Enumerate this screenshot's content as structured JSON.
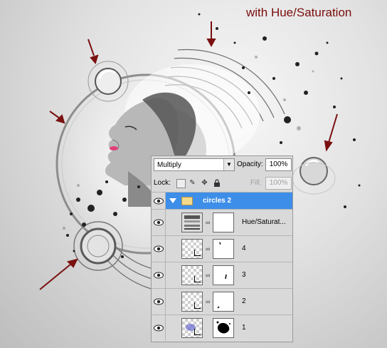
{
  "annotation": {
    "title": "with Hue/Saturation"
  },
  "layers_panel": {
    "blend_mode": "Multiply",
    "opacity_label": "Opacity:",
    "opacity_value": "100%",
    "lock_label": "Lock:",
    "fill_label": "Fill:",
    "fill_value": "100%",
    "layers": [
      {
        "name": "circles 2",
        "type": "group",
        "selected": true
      },
      {
        "name": "Hue/Saturat...",
        "type": "adjustment"
      },
      {
        "name": "4",
        "type": "layer"
      },
      {
        "name": "3",
        "type": "layer"
      },
      {
        "name": "2",
        "type": "layer"
      },
      {
        "name": "1",
        "type": "layer"
      }
    ]
  },
  "colors": {
    "annotation_red": "#7a0c0c",
    "selection_blue": "#3d8ee8",
    "arrow_red": "#7a1010"
  }
}
